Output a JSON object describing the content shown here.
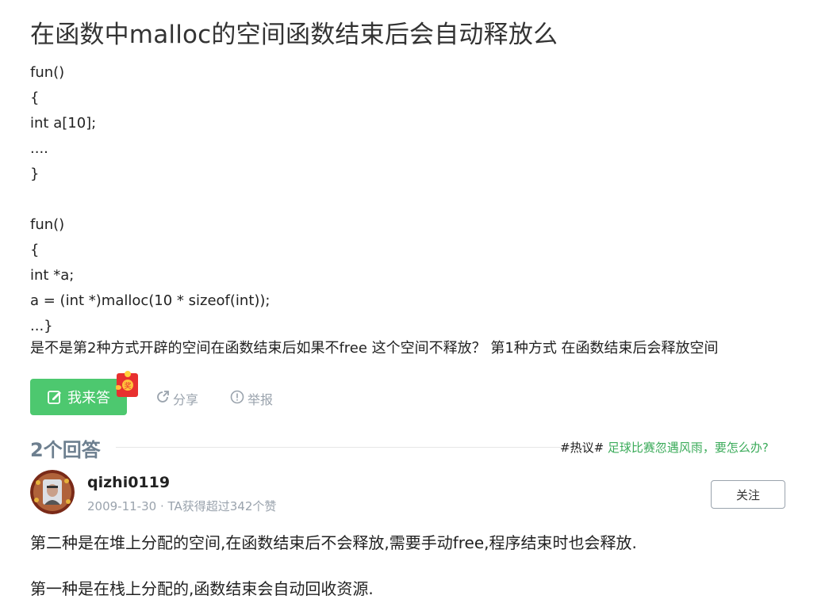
{
  "question": {
    "title": "在函数中malloc的空间函数结束后会自动释放么",
    "code_lines": [
      "fun()",
      "{",
      "int a[10];",
      "....",
      "}",
      "",
      "fun()",
      "{",
      "int *a;",
      "a = (int *)malloc(10 * sizeof(int));",
      "...}"
    ],
    "tail": "是不是第2种方式开辟的空间在函数结束后如果不free 这个空间不释放？  第1种方式 在函数结束后会释放空间"
  },
  "actions": {
    "answer_label": "我来答",
    "redpacket_text": "奖",
    "share_label": "分享",
    "report_label": "举报"
  },
  "answers_section": {
    "count_label": "2个回答",
    "hot_tag": "#热议#",
    "hot_link": "足球比赛忽遇风雨，要怎么办?"
  },
  "answer": {
    "username": "qizhi0119",
    "meta": "2009-11-30 · TA获得超过342个赞",
    "follow_label": "关注",
    "paragraphs": [
      "第二种是在堆上分配的空间,在函数结束后不会释放,需要手动free,程序结束时也会释放.",
      "第一种是在栈上分配的,函数结束会自动回收资源."
    ]
  },
  "colors": {
    "accent_green": "#4dc86f",
    "hot_link_green": "#3bab5a",
    "muted_gray": "#9aa3ad",
    "count_gray": "#6d7f8f"
  }
}
